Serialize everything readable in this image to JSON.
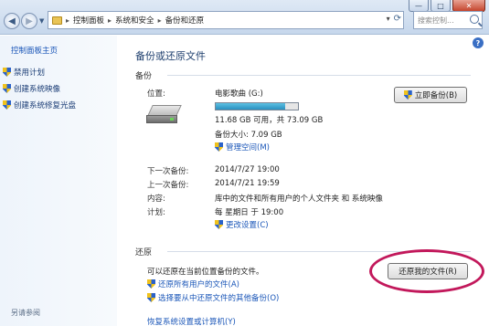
{
  "window": {
    "minimize_glyph": "—",
    "maximize_glyph": "□",
    "close_glyph": "✕"
  },
  "address_bar": {
    "crumbs": [
      "控制面板",
      "系统和安全",
      "备份和还原"
    ]
  },
  "search": {
    "placeholder": "搜索控制..."
  },
  "left_pane": {
    "home": "控制面板主页",
    "items": [
      "禁用计划",
      "创建系统映像",
      "创建系统修复光盘"
    ],
    "see_also": "另请参阅"
  },
  "main": {
    "title": "备份或还原文件",
    "backup_section": "备份",
    "location_label": "位置:",
    "drive_name": "电影歌曲 (G:)",
    "drive_space": "11.68 GB 可用，共 73.09 GB",
    "drive_used_fraction": 0.84,
    "backup_size": "备份大小: 7.09 GB",
    "manage_space_link": "管理空间(M)",
    "backup_now_button": "立即备份(B)",
    "next_backup_label": "下一次备份:",
    "next_backup_value": "2014/7/27 19:00",
    "last_backup_label": "上一次备份:",
    "last_backup_value": "2014/7/21 19:59",
    "contents_label": "内容:",
    "contents_value": "库中的文件和所有用户的个人文件夹 和 系统映像",
    "schedule_label": "计划:",
    "schedule_value": "每 星期日 于 19:00",
    "change_settings_link": "更改设置(C)",
    "restore_section": "还原",
    "restore_desc": "可以还原在当前位置备份的文件。",
    "restore_all_users_link": "还原所有用户的文件(A)",
    "choose_other_backup_link": "选择要从中还原文件的其他备份(O)",
    "restore_my_files_button": "还原我的文件(R)",
    "recover_system_link": "恢复系统设置或计算机(Y)"
  },
  "colors": {
    "highlight_ellipse": "#c2185b",
    "link": "#1a56b8",
    "progress_fill": "#2a8fbf"
  }
}
